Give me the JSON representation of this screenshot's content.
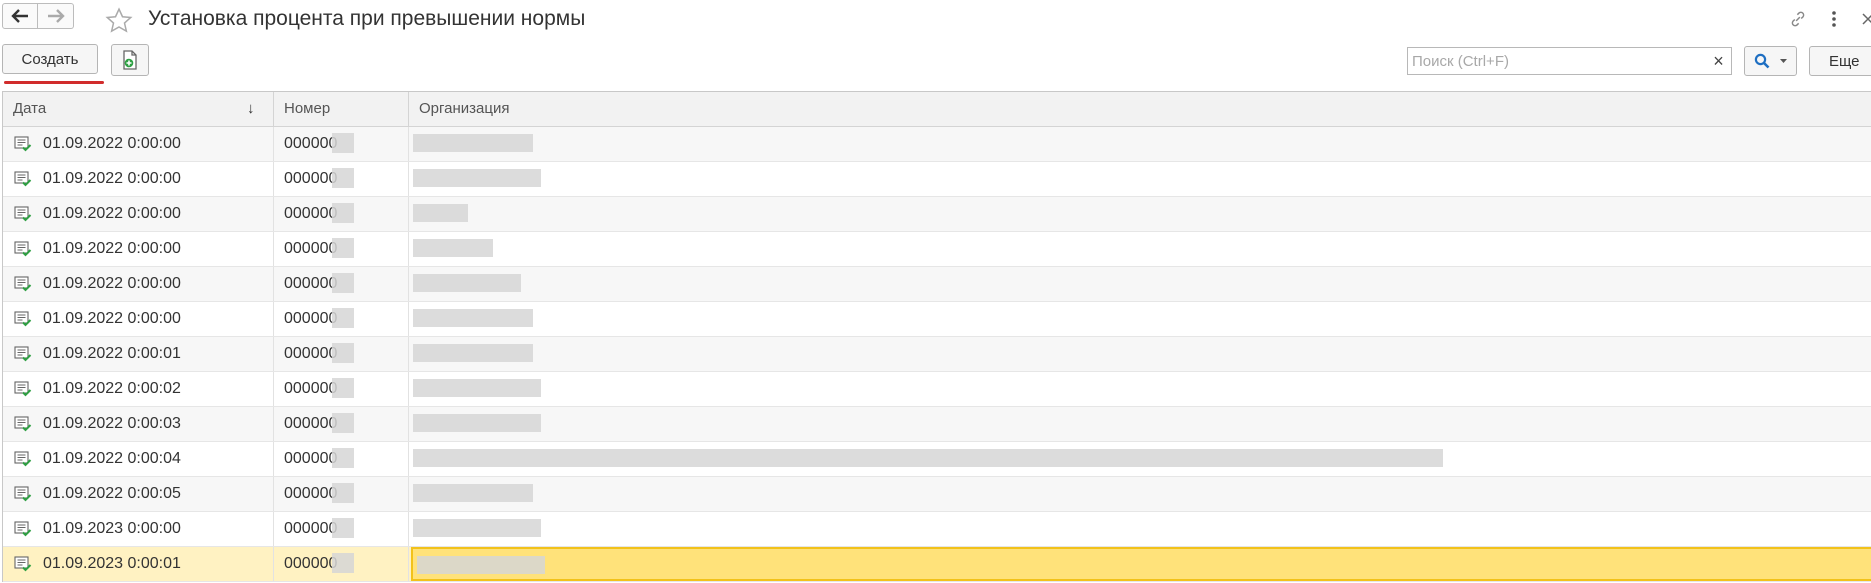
{
  "window": {
    "title": "Установка процента при превышении нормы"
  },
  "toolbar": {
    "create_label": "Создать",
    "search_placeholder": "Поиск (Ctrl+F)",
    "clear_label": "×",
    "more_label": "Еще"
  },
  "table": {
    "columns": [
      "Дата",
      "Номер",
      "Организация"
    ],
    "sort_indicator": "↓",
    "rows": [
      {
        "date": "01.09.2022 0:00:00",
        "number": "000000"
      },
      {
        "date": "01.09.2022 0:00:00",
        "number": "000000"
      },
      {
        "date": "01.09.2022 0:00:00",
        "number": "000000"
      },
      {
        "date": "01.09.2022 0:00:00",
        "number": "000000"
      },
      {
        "date": "01.09.2022 0:00:00",
        "number": "000000"
      },
      {
        "date": "01.09.2022 0:00:00",
        "number": "000000"
      },
      {
        "date": "01.09.2022 0:00:01",
        "number": "000000"
      },
      {
        "date": "01.09.2022 0:00:02",
        "number": "000000"
      },
      {
        "date": "01.09.2022 0:00:03",
        "number": "000000"
      },
      {
        "date": "01.09.2022 0:00:04",
        "number": "000000"
      },
      {
        "date": "01.09.2022 0:00:05",
        "number": "000000"
      },
      {
        "date": "01.09.2023 0:00:00",
        "number": "000000"
      },
      {
        "date": "01.09.2023 0:00:01",
        "number": "000000"
      }
    ]
  },
  "icons": {
    "back": "arrow-left-icon",
    "forward": "arrow-right-icon",
    "favorite": "star-icon",
    "link": "link-icon",
    "menu": "more-vertical-icon",
    "close": "close-icon",
    "copy": "document-copy-icon",
    "search": "magnifier-icon",
    "row": "document-posted-icon"
  },
  "colors": {
    "accent": "#d12c2c",
    "selection": "#ffe27a",
    "search_icon": "#1f6fc2"
  }
}
